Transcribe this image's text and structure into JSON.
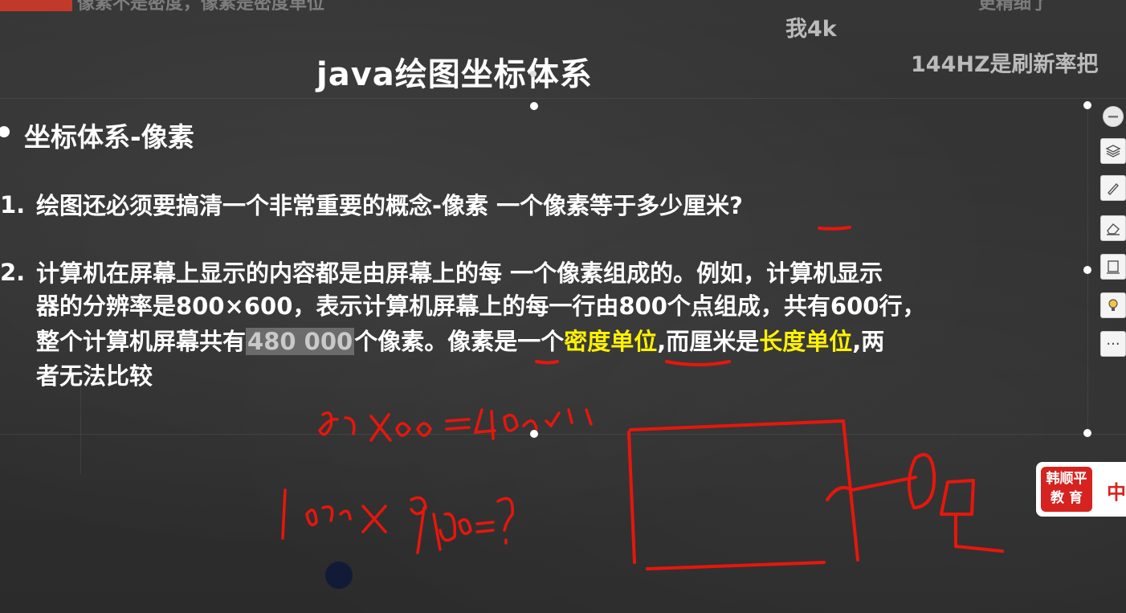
{
  "top_banner": {
    "text": "像素不是密度，像素是密度单位",
    "right_text": "更精细了"
  },
  "danmaku": [
    "我4k",
    "144HZ是刷新率把"
  ],
  "slide": {
    "title": "java绘图坐标体系",
    "section_heading": "坐标体系-像素",
    "item1": {
      "number": "1.",
      "text_a": "绘图还必须要搞清一个非常重要的概念-像素 一个像素等于多少",
      "text_b": "厘米",
      "text_c": "?"
    },
    "item2": {
      "number": "2.",
      "line1": "计算机在屏幕上显示的内容都是由屏幕上的每 一个像素组成的。例如，计算机显示",
      "line2": "器的分辨率是800×600，表示计算机屏幕上的每一行由800个点组成，共有600行，",
      "line3_a": "整个计算机屏幕共有",
      "line3_highlight": "480 000",
      "line3_b": "个像素。像素是一个",
      "line3_yellow1": "密度单位",
      "line3_c": ",而厘米是",
      "line3_yellow2": "长度单位",
      "line3_d": ",两",
      "line4": "者无法比较"
    }
  },
  "handwriting": {
    "eq1": "800×600=480000",
    "eq2": "1080×960=?"
  },
  "toolbar": {
    "tools": [
      "minus-icon",
      "layers-icon",
      "pen-icon",
      "eraser-icon",
      "frame-icon",
      "bulb-icon",
      "more-icon"
    ],
    "more_label": "···"
  },
  "logo": {
    "line1": "韩顺平",
    "line2": "教 育",
    "side": "中"
  },
  "colors": {
    "annotation_red": "#e8160c",
    "highlight_yellow": "#fff200",
    "logo_red": "#d6231f"
  }
}
